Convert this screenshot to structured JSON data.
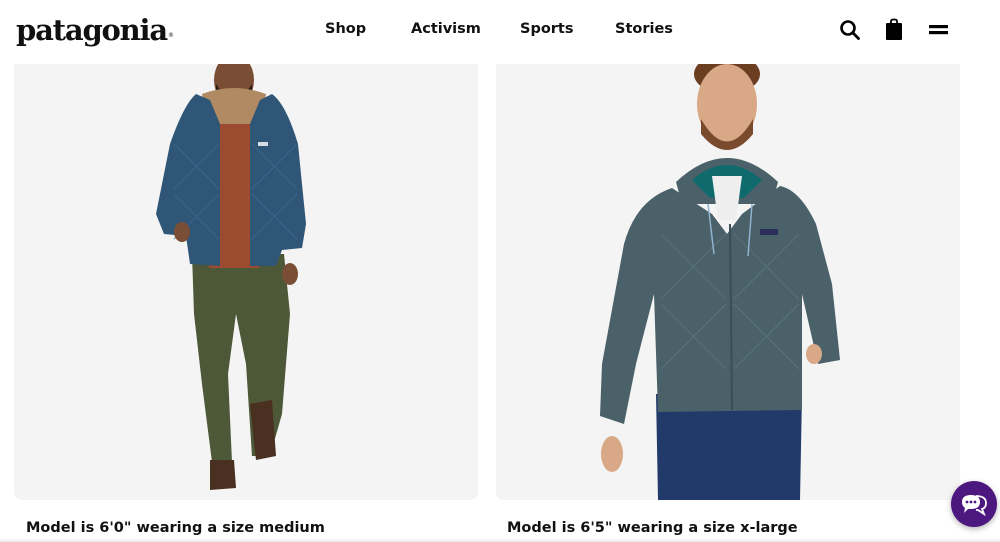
{
  "header": {
    "logo_text": "patagonia",
    "logo_mark": "®",
    "nav": [
      {
        "label": "Shop"
      },
      {
        "label": "Activism"
      },
      {
        "label": "Sports"
      },
      {
        "label": "Stories"
      }
    ],
    "icons": {
      "search": "search-icon",
      "bag": "shopping-bag-icon",
      "menu": "menu-icon"
    }
  },
  "gallery": {
    "images": [
      {
        "alt": "Model wearing blue quilted hooded jacket with rust tee and olive pants",
        "caption": "Model is 6'0\" wearing a size medium",
        "jacket_color": "#2f5577",
        "pants_color": "#4d5838",
        "shirt_color": "#9c4a30"
      },
      {
        "alt": "Model wearing slate gray quilted hooded jacket with teal lining and navy jeans",
        "caption": "Model is 6'5\" wearing a size x-large",
        "jacket_color": "#4a6169",
        "pants_color": "#223a6a",
        "lining_color": "#0f6a6e"
      }
    ]
  },
  "chat": {
    "icon": "chat-bubbles-icon",
    "color": "#4d1780"
  }
}
